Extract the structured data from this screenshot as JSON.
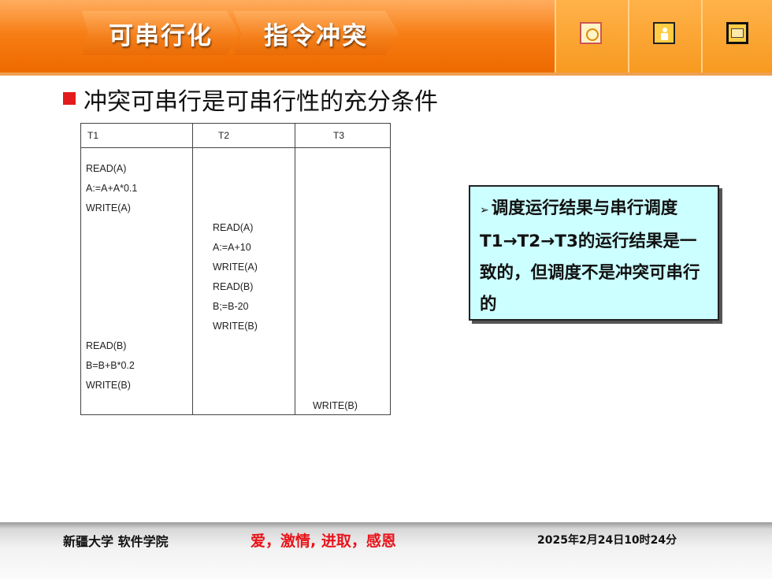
{
  "header": {
    "crumb_1": "可串行化",
    "crumb_2": "指令冲突",
    "tools": [
      {
        "icon": "home-icon"
      },
      {
        "icon": "person-icon"
      },
      {
        "icon": "mail-icon"
      }
    ]
  },
  "heading": "冲突可串行是可串行性的充分条件",
  "schedule": {
    "columns": [
      "T1",
      "T2",
      "T3"
    ],
    "t1_ops_1": [
      "READ(A)",
      "A:=A+A*0.1",
      "WRITE(A)"
    ],
    "t2_ops": [
      "READ(A)",
      "A:=A+10",
      "WRITE(A)",
      "READ(B)",
      "B;=B-20",
      "WRITE(B)"
    ],
    "t1_ops_2": [
      "READ(B)",
      "B=B+B*0.2",
      "WRITE(B)"
    ],
    "t3_ops": [
      "WRITE(B)"
    ]
  },
  "callout": {
    "marker": "➢",
    "text": "调度运行结果与串行调度T1→T2→T3的运行结果是一致的，但调度不是冲突可串行的"
  },
  "footer": {
    "school": "新疆大学 软件学院",
    "motto": "爱，激情,  进取，感恩",
    "date": "2025年2月24日10时24分"
  },
  "colors": {
    "header": "#f57a10",
    "bullet": "#e31b1b",
    "callout_bg": "#ccffff",
    "motto": "#e8141b"
  }
}
